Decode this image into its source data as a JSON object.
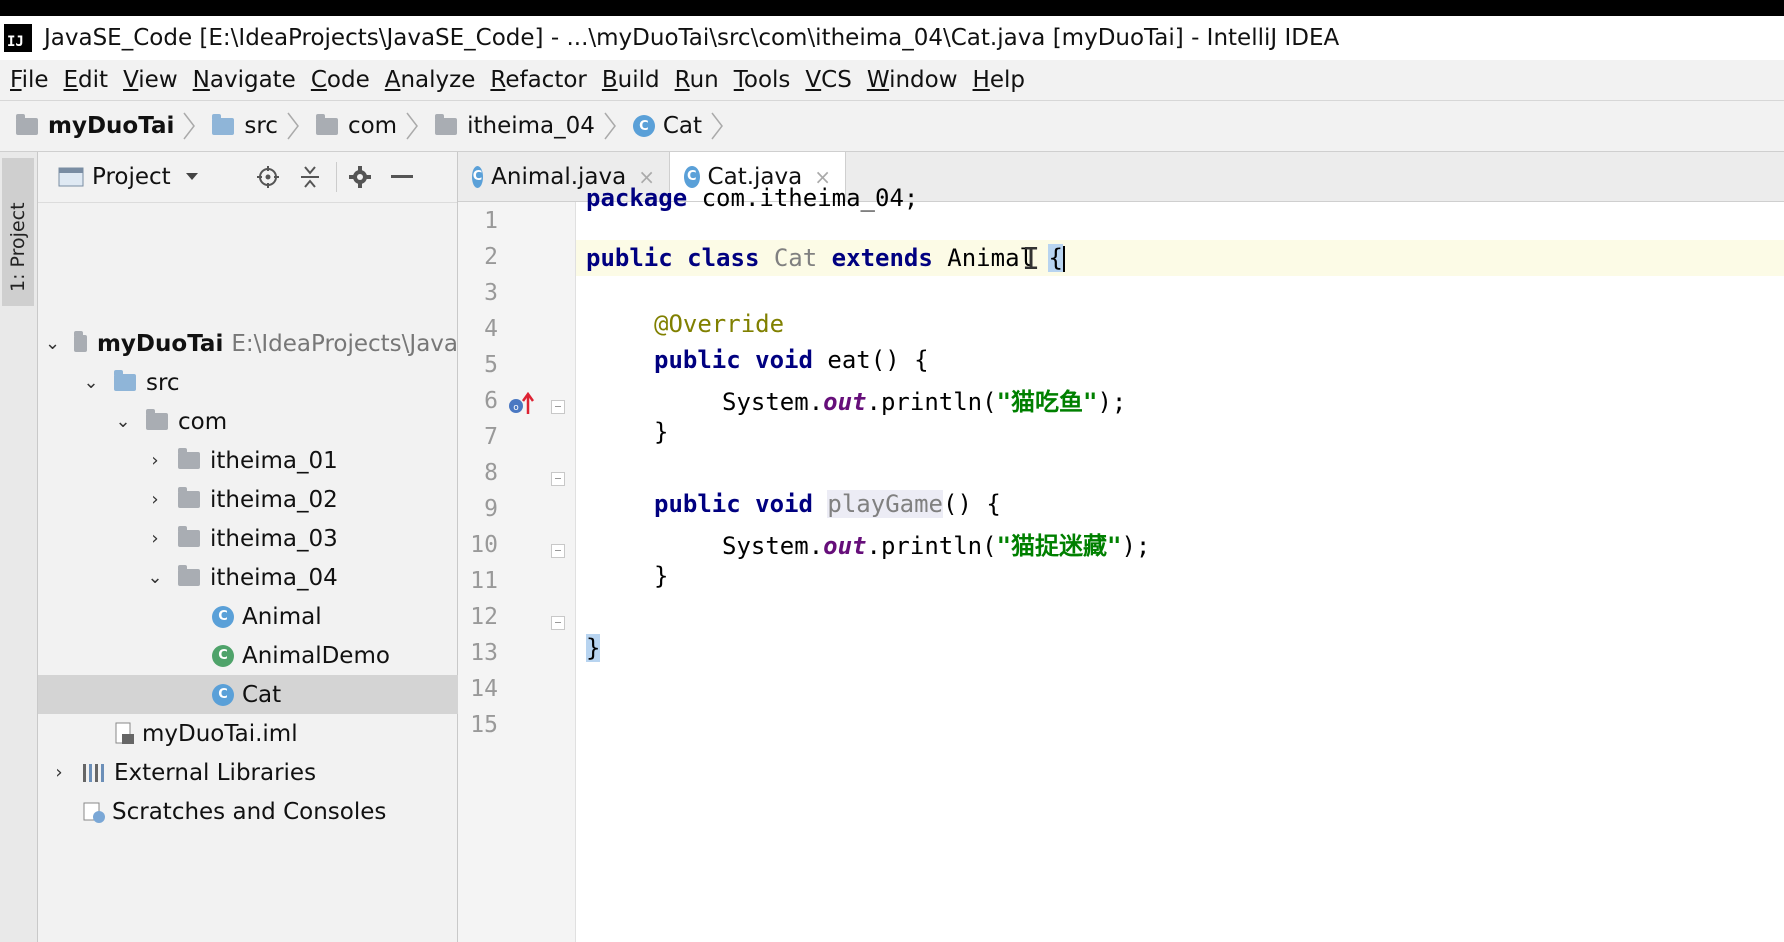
{
  "window": {
    "app_icon_text": "IJ",
    "title": "JavaSE_Code [E:\\IdeaProjects\\JavaSE_Code] - ...\\myDuoTai\\src\\com\\itheima_04\\Cat.java [myDuoTai] - IntelliJ IDEA"
  },
  "menu": [
    "File",
    "Edit",
    "View",
    "Navigate",
    "Code",
    "Analyze",
    "Refactor",
    "Build",
    "Run",
    "Tools",
    "VCS",
    "Window",
    "Help"
  ],
  "breadcrumb": [
    "myDuoTai",
    "src",
    "com",
    "itheima_04",
    "Cat"
  ],
  "tool_strip": {
    "project_label": "1: Project"
  },
  "project_panel": {
    "title": "Project",
    "tree": [
      {
        "label": "myDuoTai",
        "hint": "E:\\IdeaProjects\\Java",
        "chev": "open",
        "icon": "module-folder-icon"
      },
      {
        "label": "src",
        "chev": "open",
        "icon": "folder-icon"
      },
      {
        "label": "com",
        "chev": "open",
        "icon": "folder-icon"
      },
      {
        "label": "itheima_01",
        "chev": "closed",
        "icon": "folder-icon"
      },
      {
        "label": "itheima_02",
        "chev": "closed",
        "icon": "folder-icon"
      },
      {
        "label": "itheima_03",
        "chev": "closed",
        "icon": "folder-icon"
      },
      {
        "label": "itheima_04",
        "chev": "open",
        "icon": "folder-icon"
      },
      {
        "label": "Animal",
        "icon": "class-icon"
      },
      {
        "label": "AnimalDemo",
        "icon": "runnable-class-icon"
      },
      {
        "label": "Cat",
        "icon": "class-icon",
        "selected": true
      },
      {
        "label": "myDuoTai.iml",
        "icon": "iml-file-icon"
      },
      {
        "label": "External Libraries",
        "chev": "closed",
        "icon": "libraries-icon"
      },
      {
        "label": "Scratches and Consoles",
        "icon": "scratches-icon"
      }
    ]
  },
  "tabs": [
    {
      "label": "Animal.java",
      "active": false
    },
    {
      "label": "Cat.java",
      "active": true
    }
  ],
  "editor": {
    "line_numbers": [
      "1",
      "2",
      "3",
      "4",
      "5",
      "6",
      "7",
      "8",
      "9",
      "10",
      "11",
      "12",
      "13",
      "14",
      "15"
    ],
    "code": {
      "l1_kw": "package",
      "l1_rest": " com.itheima_04;",
      "l3_kw1": "public",
      "l3_kw2": "class",
      "l3_cls": "Cat",
      "l3_kw3": "extends",
      "l3_parent": "Animal",
      "l3_brace": "{",
      "l5_ann": "@Override",
      "l6_kw1": "public",
      "l6_kw2": "void",
      "l6_rest": " eat() {",
      "l7_sys": "System.",
      "l7_out": "out",
      "l7_call": ".println(",
      "l7_str": "\"猫吃鱼\"",
      "l7_end": ");",
      "l8": "}",
      "l10_kw1": "public",
      "l10_kw2": "void",
      "l10_method": "playGame",
      "l10_rest": "() {",
      "l11_sys": "System.",
      "l11_out": "out",
      "l11_call": ".println(",
      "l11_str": "\"猫捉迷藏\"",
      "l11_end": ");",
      "l12": "}",
      "l14": "}"
    }
  }
}
